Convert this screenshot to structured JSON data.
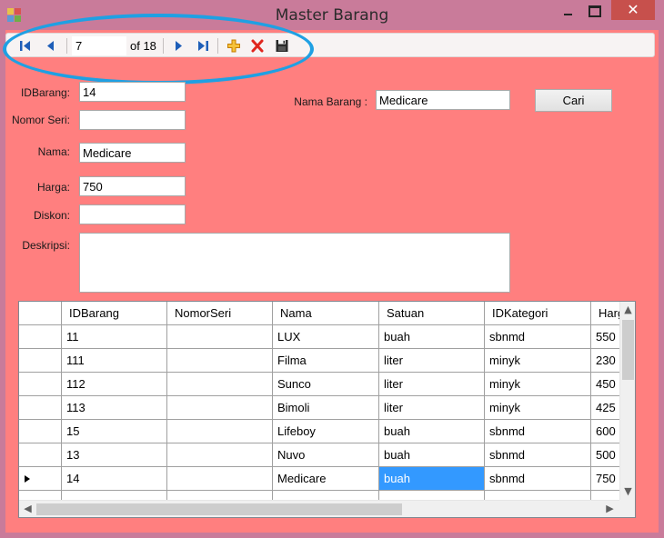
{
  "window": {
    "title": "Master Barang",
    "close_glyph": "✕"
  },
  "navigator": {
    "position": "7",
    "count_text": "of 18",
    "buttons": [
      "move-first-icon",
      "move-previous-icon",
      "move-next-icon",
      "move-last-icon",
      "add-new-icon",
      "delete-icon",
      "save-icon"
    ],
    "colors": {
      "arrow": "#1e5eb8",
      "add": "#e8a317",
      "delete": "#e0261e",
      "highlight": "#1fa0e3"
    }
  },
  "form": {
    "idbarang_label": "IDBarang:",
    "idbarang_value": "14",
    "nomorseri_label": "Nomor Seri:",
    "nomorseri_value": "",
    "nama_label": "Nama:",
    "nama_value": "Medicare",
    "harga_label": "Harga:",
    "harga_value": "750",
    "diskon_label": "Diskon:",
    "diskon_value": "",
    "deskripsi_label": "Deskripsi:",
    "deskripsi_value": "",
    "search_label": "Nama Barang :",
    "search_value": "Medicare",
    "search_button": "Cari"
  },
  "grid": {
    "columns": [
      "IDBarang",
      "NomorSeri",
      "Nama",
      "Satuan",
      "IDKategori",
      "Harga"
    ],
    "rows": [
      [
        "11",
        "",
        "LUX",
        "buah",
        "sbnmd",
        "550"
      ],
      [
        "111",
        "",
        "Filma",
        "liter",
        "minyk",
        "230"
      ],
      [
        "112",
        "",
        "Sunco",
        "liter",
        "minyk",
        "450"
      ],
      [
        "113",
        "",
        "Bimoli",
        "liter",
        "minyk",
        "425"
      ],
      [
        "15",
        "",
        "Lifeboy",
        "buah",
        "sbnmd",
        "600"
      ],
      [
        "13",
        "",
        "Nuvo",
        "buah",
        "sbnmd",
        "500"
      ],
      [
        "14",
        "",
        "Medicare",
        "buah",
        "sbnmd",
        "750"
      ]
    ],
    "current_row": 6,
    "selected_column": 3,
    "selection_color": "#3399ff"
  }
}
